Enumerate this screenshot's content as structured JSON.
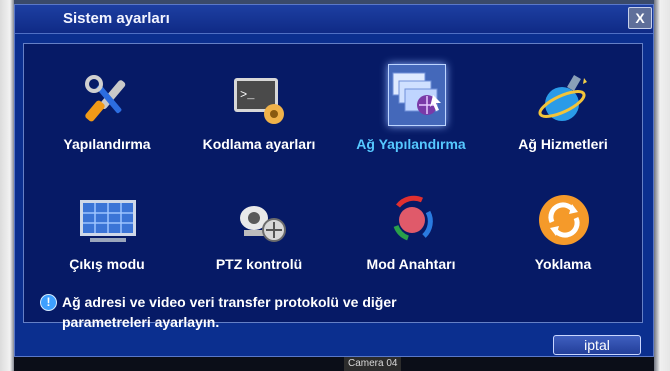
{
  "window": {
    "title": "Sistem ayarları",
    "close_label": "X"
  },
  "tiles": [
    {
      "label": "Yapılandırma",
      "icon": "wrench-screwdriver-icon"
    },
    {
      "label": "Kodlama ayarları",
      "icon": "terminal-gear-icon"
    },
    {
      "label": "Ağ Yapılandırma",
      "icon": "network-monitors-globe-icon",
      "selected": true
    },
    {
      "label": "Ağ Hizmetleri",
      "icon": "globe-satellite-icon"
    },
    {
      "label": "Çıkış modu",
      "icon": "grid-monitor-icon"
    },
    {
      "label": "PTZ kontrolü",
      "icon": "ptz-camera-icon"
    },
    {
      "label": "Mod Anahtarı",
      "icon": "mode-switch-icon"
    },
    {
      "label": "Yoklama",
      "icon": "refresh-cycle-icon"
    }
  ],
  "info_text_line1": "Ağ adresi ve video veri transfer protokolü ve diğer",
  "info_text_line2": "parametreleri ayarlayın.",
  "cancel_label": "iptal",
  "background": {
    "camera_label": "Camera 04"
  },
  "colors": {
    "dialog": "#0b2f8f",
    "panel": "#061a66",
    "selected_text": "#56c8ff"
  }
}
